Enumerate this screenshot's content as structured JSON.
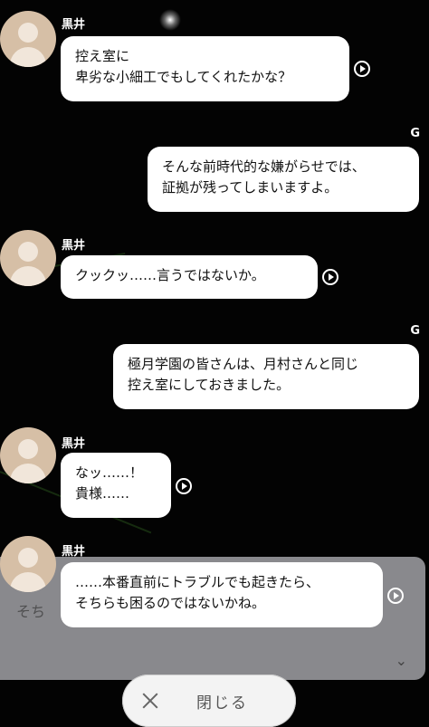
{
  "messages": [
    {
      "speaker": "黒井",
      "lines": [
        "控え室に",
        "卑劣な小細工でもしてくれたかな？"
      ]
    },
    {
      "speaker": "G",
      "lines": [
        "そんな前時代的な嫌がらせでは、",
        "証拠が残ってしまいますよ。"
      ]
    },
    {
      "speaker": "黒井",
      "lines": [
        "クックッ……言うではないか。"
      ]
    },
    {
      "speaker": "G",
      "lines": [
        "極月学園の皆さんは、月村さんと同じ",
        "控え室にしておきました。"
      ]
    },
    {
      "speaker": "黒井",
      "lines": [
        "なッ……！",
        "貴様……"
      ]
    },
    {
      "speaker": "黒井",
      "lines": [
        "……本番直前にトラブルでも起きたら、",
        "そちらも困るのではないかね。"
      ]
    }
  ],
  "background": {
    "ghost_text": "そち"
  },
  "close_button": {
    "label": "閉じる"
  },
  "icons": {
    "play": "play-circle-icon",
    "close": "close-x-icon",
    "avatar": "person-avatar-icon",
    "chevron": "chevron-down-icon"
  },
  "colors": {
    "background": "#030303",
    "bubble": "#ffffff",
    "avatar": "#d6bfa6"
  }
}
